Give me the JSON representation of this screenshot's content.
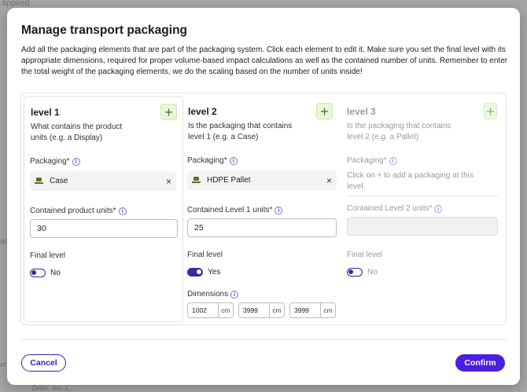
{
  "background": {
    "top_text": "applied",
    "left_text": "ast",
    "bottom_left": "et",
    "bottom_text": "Zeilin, Inc. L..."
  },
  "modal": {
    "title": "Manage transport packaging",
    "description": "Add all the packaging elements that are part of the packaging system. Click each element to edit it. Make sure you set the final level with its appropriate dimensions, required for proper volume-based impact calculations as well as the contained number of units. Remember to enter the total weight of the packaging elements, we do the scaling based on the number of units inside!"
  },
  "levels": [
    {
      "title": "level 1",
      "subtitle": "What contains the product units (e.g. a Display)",
      "packaging_label": "Packaging*",
      "packaging_value": "Case",
      "units_label": "Contained product units*",
      "units_value": "30",
      "final_label": "Final level",
      "final_value": "No"
    },
    {
      "title": "level 2",
      "subtitle": "Is the packaging that contains level 1 (e.g. a Case)",
      "packaging_label": "Packaging*",
      "packaging_value": "HDPE Pallet",
      "units_label": "Contained Level 1 units*",
      "units_value": "25",
      "final_label": "Final level",
      "final_value": "Yes",
      "dimensions_label": "Dimensions",
      "dimensions": [
        {
          "value": "1002",
          "unit": "cm"
        },
        {
          "value": "3999",
          "unit": "cm"
        },
        {
          "value": "3999",
          "unit": "cm"
        }
      ]
    },
    {
      "title": "level 3",
      "subtitle": "Is the packaging that contains level 2 (e.g. a Pallet)",
      "packaging_label": "Packaging*",
      "packaging_hint": "Click on + to add a packaging at this level.",
      "units_label": "Contained Level 2 units*",
      "units_value": "",
      "final_label": "Final level",
      "final_value": "No"
    }
  ],
  "icons": {
    "plus": "+",
    "info": "i",
    "close": "×"
  },
  "footer": {
    "cancel_label": "Cancel",
    "confirm_label": "Confirm"
  },
  "colors": {
    "primary": "#4c1ee0",
    "toggle": "#3a2a9e",
    "plus_bg": "#e9f6d8",
    "plus_fg": "#3e7d1c"
  }
}
